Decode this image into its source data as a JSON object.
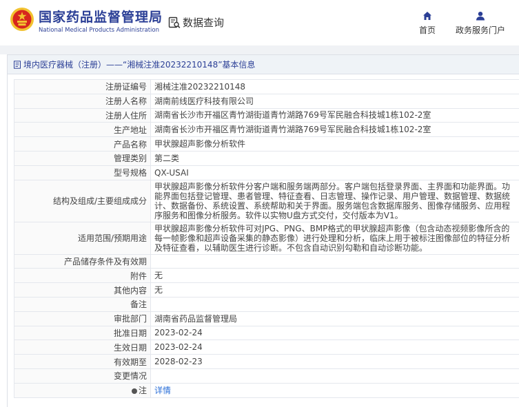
{
  "header": {
    "site_name_cn": "国家药品监督管理局",
    "site_name_en": "National Medical Products Administration",
    "query_label": "数据查询",
    "nav": [
      {
        "label": "首页",
        "icon": "home-icon"
      },
      {
        "label": "政务服务门户",
        "icon": "user-icon"
      }
    ]
  },
  "panel": {
    "title": "境内医疗器械（注册）——“湘械注准20232210148”基本信息"
  },
  "rows": [
    {
      "key": "注册证编号",
      "value": "湘械注准20232210148"
    },
    {
      "key": "注册人名称",
      "value": "湖南前线医疗科技有限公司"
    },
    {
      "key": "注册人住所",
      "value": "湖南省长沙市开福区青竹湖街道青竹湖路769号军民融合科技城1栋102-2室"
    },
    {
      "key": "生产地址",
      "value": "湖南省长沙市开福区青竹湖街道青竹湖路769号军民融合科技城1栋102-2室"
    },
    {
      "key": "产品名称",
      "value": "甲状腺超声影像分析软件"
    },
    {
      "key": "管理类别",
      "value": "第二类"
    },
    {
      "key": "型号规格",
      "value": "QX-USAI"
    },
    {
      "key": "结构及组成/主要组成成分",
      "value": "甲状腺超声影像分析软件分客户端和服务端两部分。客户端包括登录界面、主界面和功能界面。功能界面包括登记管理、患者管理、特征查看、日志管理、操作记录、用户管理、数据管理、数据统计、数据备份、系统设置、系统帮助和关于界面。服务端包含数据库服务、图像存储服务、应用程序服务和图像分析服务。软件以实物U盘方式交付，交付版本为V1。"
    },
    {
      "key": "适用范围/预期用途",
      "value": "甲状腺超声影像分析软件可对JPG、PNG、BMP格式的甲状腺超声影像（包含动态视频影像所含的每一帧影像和超声设备采集的静态影像）进行处理和分析，临床上用于被标注图像部位的特征分析及特征查看，以辅助医生进行诊断。不包含自动识别勾勒和自动诊断功能。"
    },
    {
      "key": "产品储存条件及有效期",
      "value": ""
    },
    {
      "key": "附件",
      "value": "无"
    },
    {
      "key": "其他内容",
      "value": "无"
    },
    {
      "key": "备注",
      "value": ""
    },
    {
      "key": "审批部门",
      "value": "湖南省药品监督管理局"
    },
    {
      "key": "批准日期",
      "value": "2023-02-24"
    },
    {
      "key": "生效日期",
      "value": "2023-02-24"
    },
    {
      "key": "有效期至",
      "value": "2028-02-23"
    },
    {
      "key": "变更情况",
      "value": ""
    },
    {
      "key": "注",
      "value": "详情"
    }
  ],
  "colors": {
    "brand": "#2b3f96",
    "link": "#2b6fd8",
    "emblem_red": "#d7261e",
    "emblem_gold": "#f2c230"
  }
}
